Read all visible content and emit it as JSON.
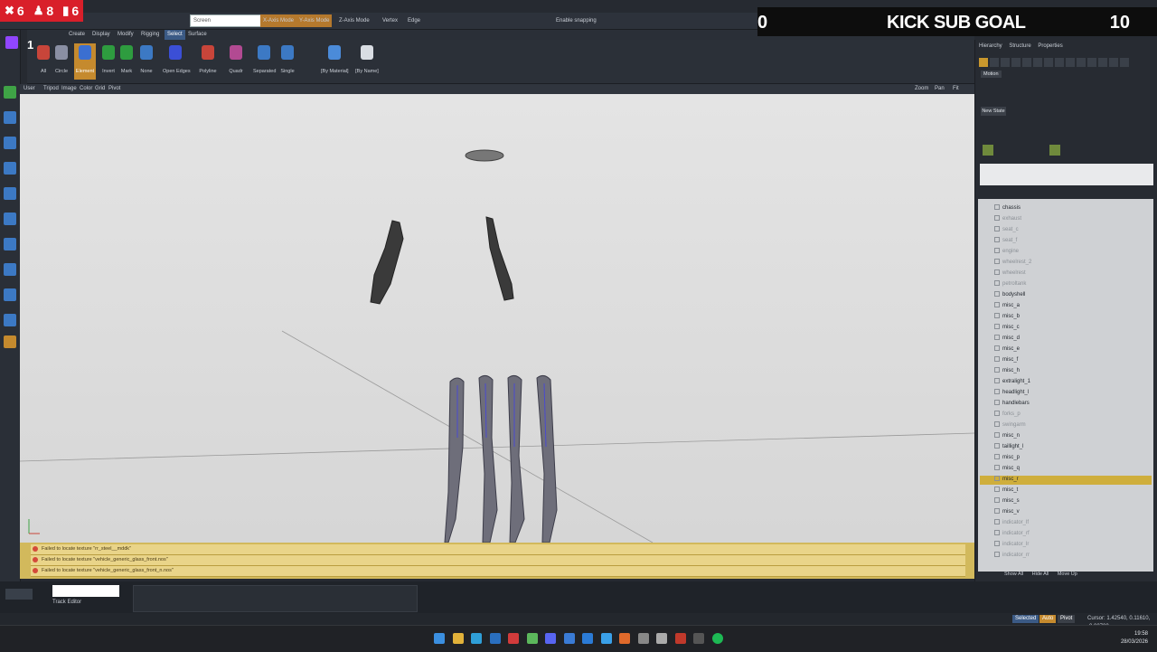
{
  "overlay": {
    "badges": [
      {
        "glyph": "✖",
        "value": "6",
        "color": "#d91f2a"
      },
      {
        "glyph": "♟",
        "value": "8",
        "color": "#d91f2a"
      },
      {
        "glyph": "▮",
        "value": "6",
        "color": "#d91f2a"
      }
    ],
    "sub_goal": {
      "current": "0",
      "label": "KICK SUB GOAL",
      "target": "10"
    },
    "stream_number": "1"
  },
  "toolbar": {
    "screen_field": "Screen",
    "x_axis": "X-Axis Mode",
    "y_axis": "Y-Axis Mode",
    "z_axis": "Z-Axis Mode",
    "vertex": "Vertex",
    "edge": "Edge",
    "snapping": "Enable snapping"
  },
  "menu": [
    "Create",
    "Display",
    "Modify",
    "Rigging",
    "Select",
    "Surface"
  ],
  "ribbon": {
    "buttons": [
      "All",
      "Circle",
      "Element",
      "Invert",
      "Mark",
      "None",
      "Open Edges",
      "Polyline",
      "Quadr",
      "Separated",
      "Single",
      "[By Material]",
      "[By Name]"
    ],
    "selected": "Element"
  },
  "viewport": {
    "menu": [
      "User",
      "Tripod",
      "Image",
      "Color",
      "Grid",
      "Pivot"
    ],
    "right_tools": [
      "Zoom",
      "Pan",
      "Fit"
    ]
  },
  "console": [
    "Failed to locate texture \"rr_steel__mddk\"",
    "Failed to locate texture \"vehicle_generic_glass_front.nos\"",
    "Failed to locate texture \"vehicle_generic_glass_front_n.nos\""
  ],
  "right_panel": {
    "tabs": [
      "Hierarchy",
      "Structure",
      "Properties"
    ],
    "motion_label": "Motion",
    "new_state_label": "New State",
    "tree": [
      {
        "label": "chassis",
        "dim": false
      },
      {
        "label": "exhaust",
        "dim": true
      },
      {
        "label": "seat_c",
        "dim": true
      },
      {
        "label": "seat_f",
        "dim": true
      },
      {
        "label": "engine",
        "dim": true
      },
      {
        "label": "wheelrest_2",
        "dim": true
      },
      {
        "label": "wheelrest",
        "dim": true
      },
      {
        "label": "petroltank",
        "dim": true
      },
      {
        "label": "bodyshell",
        "dim": false
      },
      {
        "label": "misc_a",
        "dim": false
      },
      {
        "label": "misc_b",
        "dim": false
      },
      {
        "label": "misc_c",
        "dim": false
      },
      {
        "label": "misc_d",
        "dim": false
      },
      {
        "label": "misc_e",
        "dim": false
      },
      {
        "label": "misc_f",
        "dim": false
      },
      {
        "label": "misc_h",
        "dim": false
      },
      {
        "label": "extralight_1",
        "dim": false
      },
      {
        "label": "headlight_l",
        "dim": false
      },
      {
        "label": "handlebars",
        "dim": false
      },
      {
        "label": "forks_p",
        "dim": true
      },
      {
        "label": "swingarm",
        "dim": true
      },
      {
        "label": "misc_n",
        "dim": false
      },
      {
        "label": "taillight_l",
        "dim": false
      },
      {
        "label": "misc_p",
        "dim": false
      },
      {
        "label": "misc_q",
        "dim": false
      },
      {
        "label": "misc_r",
        "dim": false
      },
      {
        "label": "misc_t",
        "dim": false
      },
      {
        "label": "misc_s",
        "dim": false
      },
      {
        "label": "misc_v",
        "dim": false
      },
      {
        "label": "indicator_lf",
        "dim": true
      },
      {
        "label": "indicator_rf",
        "dim": true
      },
      {
        "label": "indicator_lr",
        "dim": true
      },
      {
        "label": "indicator_rr",
        "dim": true
      }
    ],
    "selected_index": 25,
    "footer": [
      "Show All",
      "Hide All",
      "Move Up"
    ]
  },
  "timeline": {
    "track_editor": "Track Editor"
  },
  "status": {
    "selected": "Selected",
    "auto": "Auto",
    "pivot": "Pivot",
    "cursor": "Cursor: 1.42540, 0.11610, -0.00700"
  },
  "taskbar": {
    "time": "19:58",
    "date": "28/03/2026"
  }
}
